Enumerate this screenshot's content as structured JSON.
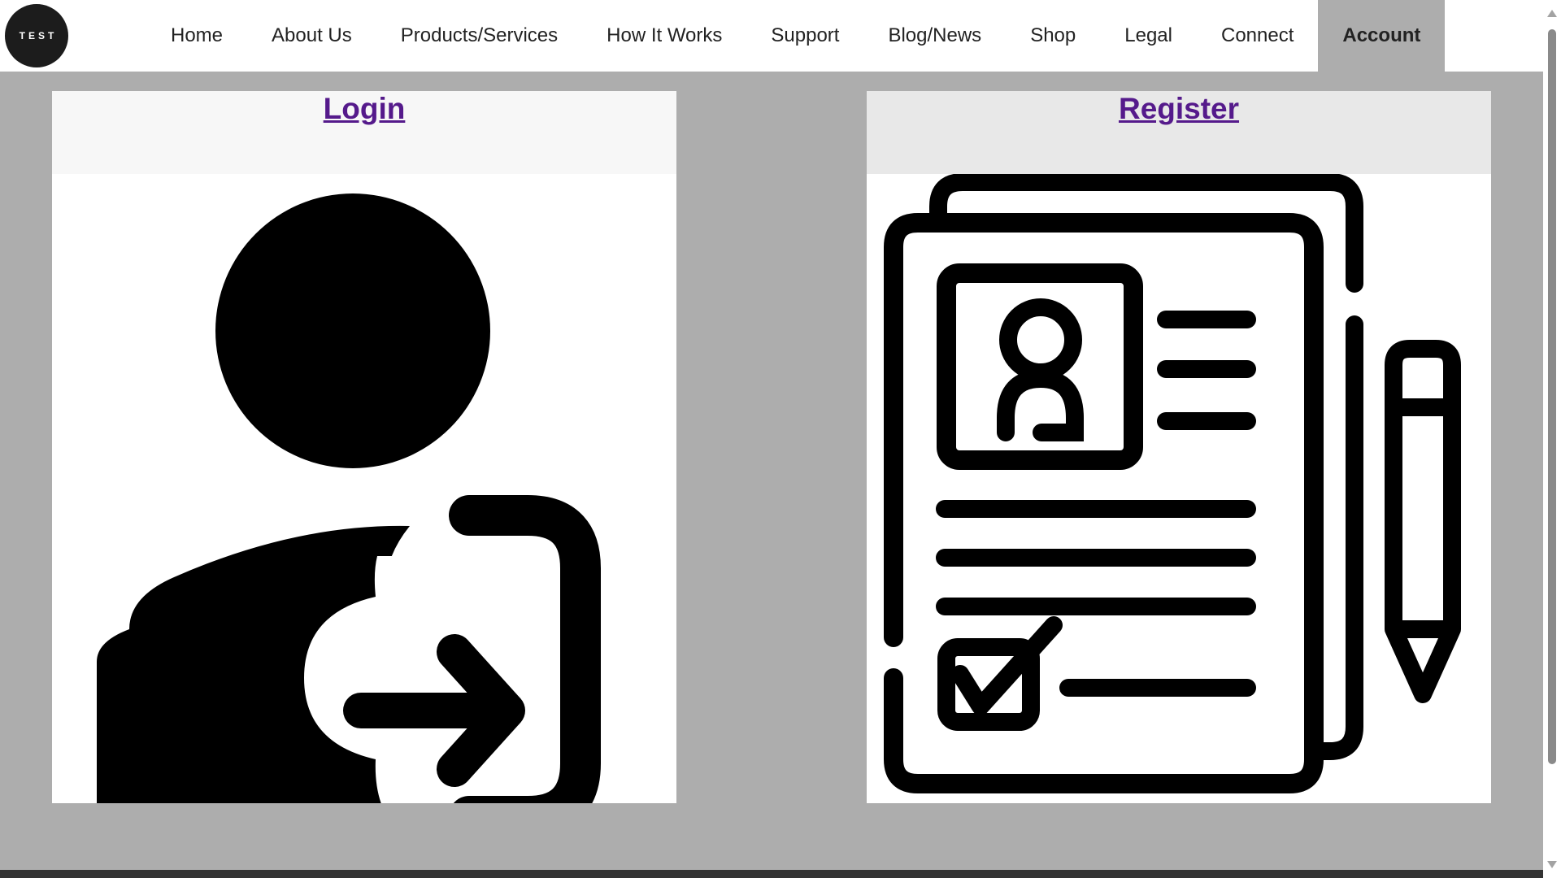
{
  "logo": {
    "text": "TEST"
  },
  "nav": {
    "items": [
      {
        "label": "Home"
      },
      {
        "label": "About Us"
      },
      {
        "label": "Products/Services"
      },
      {
        "label": "How It Works"
      },
      {
        "label": "Support"
      },
      {
        "label": "Blog/News"
      },
      {
        "label": "Shop"
      },
      {
        "label": "Legal"
      },
      {
        "label": "Connect"
      },
      {
        "label": "Account",
        "active": true
      }
    ]
  },
  "cards": {
    "login": {
      "label": "Login",
      "icon": "user-login-icon"
    },
    "register": {
      "label": "Register",
      "icon": "registration-form-icon"
    }
  },
  "colors": {
    "background": "#adadad",
    "link": "#551a8b",
    "active_nav": "#adadad",
    "icon": "#000000"
  }
}
